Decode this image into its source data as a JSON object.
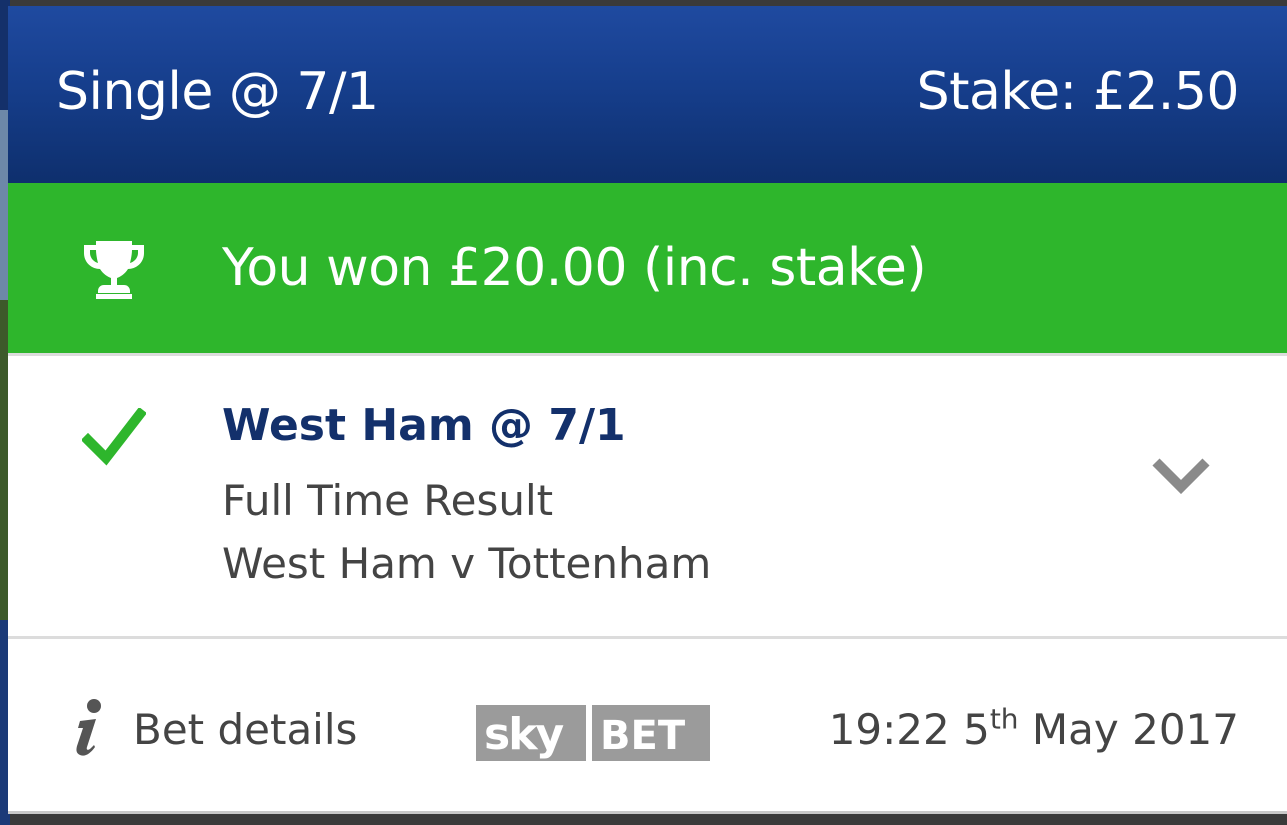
{
  "header": {
    "title": "Single @ 7/1",
    "stake": "Stake: £2.50"
  },
  "result_banner": {
    "icon": "trophy-icon",
    "text": "You won £20.00 (inc. stake)",
    "color": "#2eb62c"
  },
  "selection": {
    "status_icon": "checkmark-icon",
    "title": "West Ham @ 7/1",
    "market": "Full Time Result",
    "event": "West Ham v Tottenham",
    "expand_icon": "chevron-down-icon"
  },
  "footer": {
    "info_icon": "info-icon",
    "bet_details_label": "Bet details",
    "logo": {
      "left": "sky",
      "right": "BET"
    },
    "datetime": {
      "time": "19:22",
      "day": "5",
      "day_suffix": "th",
      "month_year": "May 2017"
    }
  },
  "colors": {
    "header_top": "#1f4aa0",
    "header_bottom": "#0e2f6d",
    "success_green": "#2eb62c",
    "title_navy": "#13306b",
    "text_grey": "#444444"
  }
}
